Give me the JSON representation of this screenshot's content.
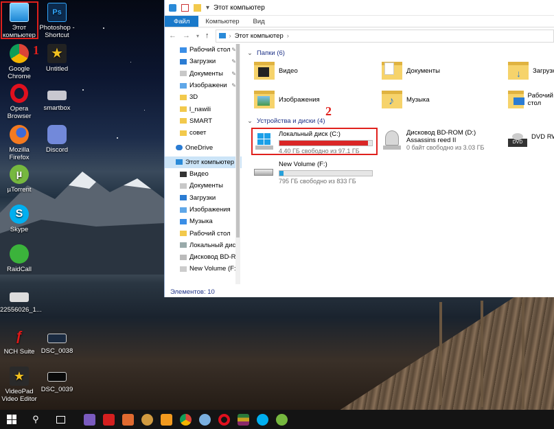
{
  "desktop": {
    "icons": [
      {
        "label": "Этот компьютер",
        "icon": "computer-icon"
      },
      {
        "label": "Photoshop - Shortcut",
        "icon": "photoshop-icon"
      },
      {
        "label": "Google Chrome",
        "icon": "chrome-icon"
      },
      {
        "label": "Untitled",
        "icon": "star-icon"
      },
      {
        "label": "Opera Browser",
        "icon": "opera-icon"
      },
      {
        "label": "smartbox",
        "icon": "smartbox-icon"
      },
      {
        "label": "Mozilla Firefox",
        "icon": "firefox-icon"
      },
      {
        "label": "Discord",
        "icon": "discord-icon"
      },
      {
        "label": "µTorrent",
        "icon": "utorrent-icon"
      },
      {
        "label": "Skype",
        "icon": "skype-icon"
      },
      {
        "label": "RaidCall",
        "icon": "raidcall-icon"
      },
      {
        "label": "22556026_1...",
        "icon": "image-file-icon"
      },
      {
        "label": "NCH Suite",
        "icon": "nch-icon"
      },
      {
        "label": "DSC_0038",
        "icon": "image-file-icon"
      },
      {
        "label": "VideoPad Video Editor",
        "icon": "videopad-icon"
      },
      {
        "label": "DSC_0039",
        "icon": "image-file-icon"
      }
    ],
    "annotations": {
      "mark1": "1",
      "mark2": "2"
    }
  },
  "explorer": {
    "title": "Этот компьютер",
    "ribbon_tabs": [
      "Файл",
      "Компьютер",
      "Вид"
    ],
    "breadcrumb": [
      "Этот компьютер"
    ],
    "nav_quick": [
      {
        "label": "Рабочий стол",
        "pinned": true
      },
      {
        "label": "Загрузки",
        "pinned": true
      },
      {
        "label": "Документы",
        "pinned": true
      },
      {
        "label": "Изображени",
        "pinned": true
      },
      {
        "label": "3D",
        "pinned": false
      },
      {
        "label": "l_nawili",
        "pinned": false
      },
      {
        "label": "SMART",
        "pinned": false
      },
      {
        "label": "совет",
        "pinned": false
      }
    ],
    "nav_onedrive": "OneDrive",
    "nav_thispc": "Этот компьютер",
    "nav_pc_children": [
      "Видео",
      "Документы",
      "Загрузки",
      "Изображения",
      "Музыка",
      "Рабочий стол",
      "Локальный дис",
      "Дисковод BD-R",
      "New Volume (F:)"
    ],
    "folders_header": "Папки (6)",
    "folders": [
      "Видео",
      "Документы",
      "Загрузки",
      "Изображения",
      "Музыка",
      "Рабочий стол"
    ],
    "devices_header": "Устройства и диски (4)",
    "drives": [
      {
        "name": "Локальный диск (C:)",
        "free": "4.40 ГБ свободно из 97.1 ГБ",
        "used_fraction": 0.955,
        "bar_color": "#da2626"
      },
      {
        "name": "Дисковод BD-ROM (D:) Assassins reed II",
        "free": "0 байт свободно из 3.03 ГБ"
      },
      {
        "name": "DVD RW",
        "free": ""
      },
      {
        "name": "New Volume (F:)",
        "free": "795 ГБ свободно из 833 ГБ",
        "used_fraction": 0.046,
        "bar_color": "#26a0da"
      }
    ],
    "status": "Элементов: 10"
  },
  "colors": {
    "accent": "#1979ca",
    "highlight": "#e0201c",
    "selection": "#cce4f7"
  }
}
